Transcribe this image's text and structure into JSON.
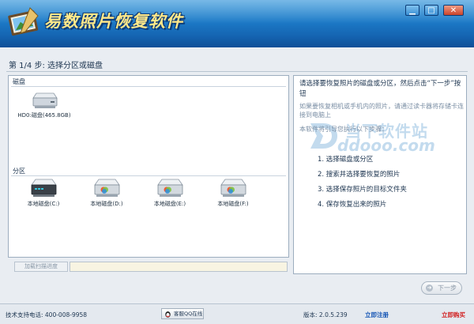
{
  "app": {
    "title": "易数照片恢复软件",
    "window_controls": {
      "minimize": "▁",
      "maximize": "□",
      "close": "✕"
    }
  },
  "step": {
    "label": "第 1/4 步: 选择分区或磁盘"
  },
  "disks": {
    "section_label": "磁盘",
    "items": [
      {
        "label": "HD0:磁盘(465.8GB)",
        "icon": "hard-disk-icon"
      }
    ]
  },
  "partitions": {
    "section_label": "分区",
    "items": [
      {
        "label": "本地磁盘(C:)",
        "icon": "system-drive-icon"
      },
      {
        "label": "本地磁盘(D:)",
        "icon": "local-drive-icon"
      },
      {
        "label": "本地磁盘(E:)",
        "icon": "local-drive-icon"
      },
      {
        "label": "本地磁盘(F:)",
        "icon": "local-drive-icon"
      }
    ]
  },
  "instructions": {
    "main": "请选择要恢复照片的磁盘或分区，然后点击“下一步”按钮",
    "note": "如果要恢复相机或手机内的照片，请通过读卡器将存储卡连接到电脑上",
    "guide": "本软件将引导您执行以下步骤：",
    "steps": [
      "1.  选择磁盘或分区",
      "2.  搜索并选择要恢复的照片",
      "3.  选择保存照片的目标文件夹",
      "4.  保存恢复出来的照片"
    ]
  },
  "watermark": {
    "line1": "当下软件站",
    "line2": "ddooo.com"
  },
  "progress": {
    "label": "加载扫描进度",
    "value": 0
  },
  "navigation": {
    "next_label": "下一步",
    "next_icon": "arrow-right-icon"
  },
  "status_bar": {
    "support": "技术支持电话: 400-008-9958",
    "qq_button": "客服QQ在线",
    "version": "版本: 2.0.5.239",
    "register": "立即注册",
    "buy": "立即购买"
  },
  "colors": {
    "header_top": "#2f93d9",
    "header_bottom": "#0f4f97",
    "title_text": "#ffe88a",
    "register_link": "#1656b5",
    "buy_link": "#d11e1e",
    "progress_fill": "#4fa64f"
  }
}
